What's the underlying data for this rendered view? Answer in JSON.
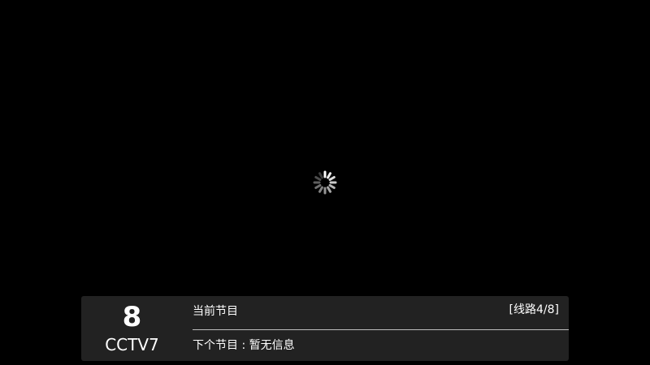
{
  "colors": {
    "background": "#000000",
    "info_bar": "#222222",
    "text": "#ffffff",
    "divider": "#bdbdbd"
  },
  "icons": {
    "spinner": "loading-spinner-icon"
  },
  "channel": {
    "number": "8",
    "name": "CCTV7"
  },
  "program": {
    "current_label": "当前节目",
    "next_label": "下个节目 : 暂无信息"
  },
  "line": {
    "indicator": "[线路4/8]"
  }
}
